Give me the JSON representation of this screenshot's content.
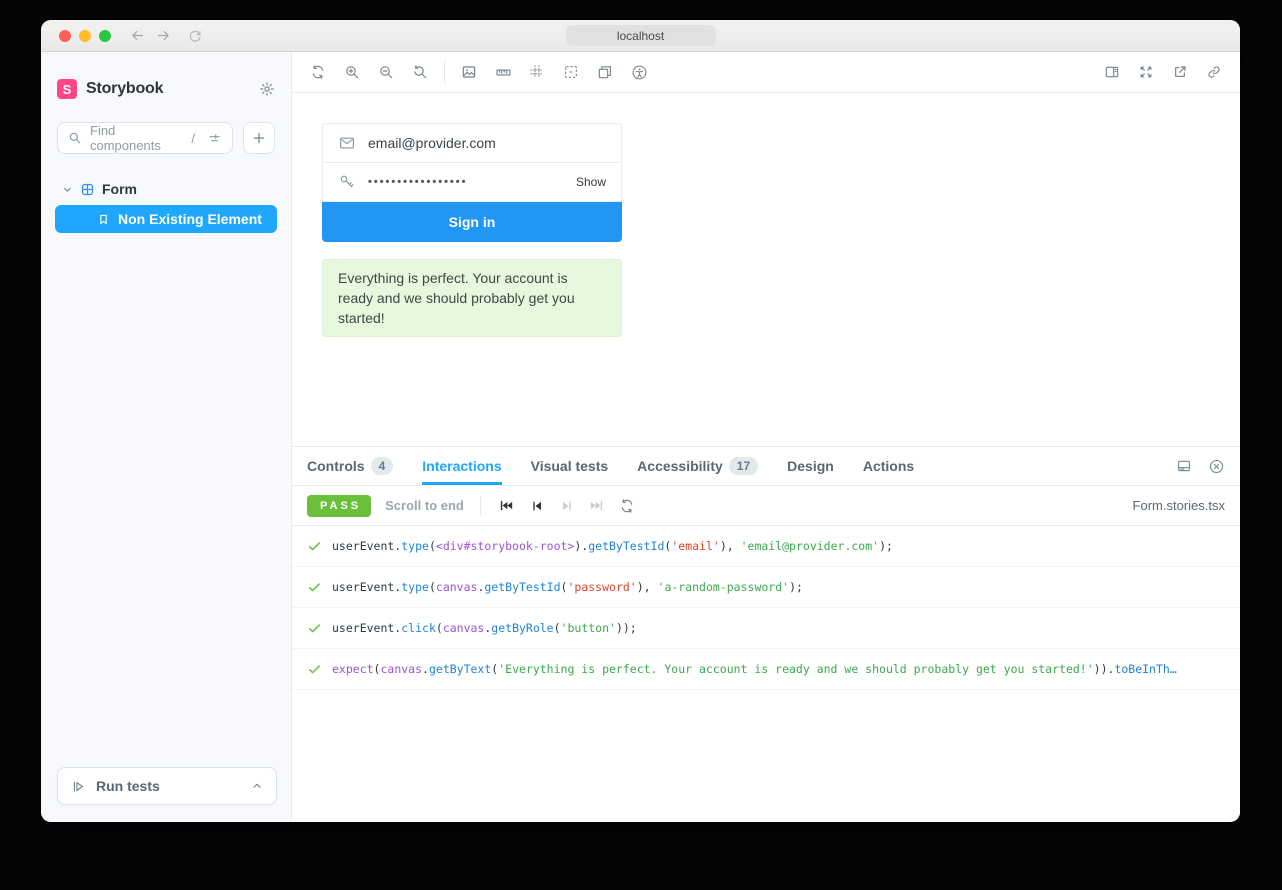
{
  "browser": {
    "url": "localhost",
    "traffic_lights": {
      "close": "#FF5F57",
      "minimize": "#FEBC2E",
      "zoom": "#28C840"
    },
    "nav_icons": [
      "back-arrow-icon",
      "forward-arrow-icon",
      "reload-icon"
    ]
  },
  "sidebar": {
    "brand": {
      "logo_letter": "S",
      "name": "Storybook",
      "logo_color": "#FF4785"
    },
    "search": {
      "placeholder": "Find components",
      "shortcut": "/",
      "icons": [
        "search-icon",
        "filter-icon",
        "plus-icon"
      ]
    },
    "tree": {
      "group": {
        "label": "Form",
        "icons": [
          "chevron-down-icon",
          "component-icon"
        ]
      },
      "selected_story": {
        "label": "Non Existing Element",
        "icon": "bookmark-icon",
        "bg": "#1EA7FD"
      }
    },
    "run_tests": {
      "label": "Run tests",
      "icons": [
        "play-tests-icon",
        "chevron-up-icon"
      ]
    }
  },
  "canvas_toolbar": {
    "left_icons": [
      "remount-icon",
      "zoom-in-icon",
      "zoom-out-icon",
      "zoom-reset-icon",
      "background-icon",
      "measure-icon",
      "grid-icon",
      "outline-icon",
      "viewport-icon",
      "accessibility-icon"
    ],
    "right_icons": [
      "panel-position-icon",
      "fullscreen-icon",
      "open-external-icon",
      "link-icon"
    ]
  },
  "story": {
    "email_value": "email@provider.com",
    "password_mask": "•••••••••••••••••",
    "show_label": "Show",
    "sign_in_label": "Sign in",
    "sign_in_color": "#2196F3",
    "success_message": "Everything is perfect. Your account is ready and we should probably get you started!",
    "success_bg": "#E6F9DF"
  },
  "panel": {
    "tabs": [
      {
        "label": "Controls",
        "badge": "4",
        "active": false
      },
      {
        "label": "Interactions",
        "badge": "",
        "active": true
      },
      {
        "label": "Visual tests",
        "badge": "",
        "active": false
      },
      {
        "label": "Accessibility",
        "badge": "17",
        "active": false
      },
      {
        "label": "Design",
        "badge": "",
        "active": false
      },
      {
        "label": "Actions",
        "badge": "",
        "active": false
      }
    ],
    "right_icons": [
      "panel-bottom-icon",
      "close-panel-icon"
    ],
    "accent": "#1EA7FD"
  },
  "interactions": {
    "status": "PASS",
    "status_color": "#6ABF3B",
    "scroll_to_end": "Scroll to end",
    "playback_icons": [
      "go-to-start-icon",
      "step-back-icon",
      "step-forward-icon",
      "go-to-end-icon",
      "rerun-icon"
    ],
    "file": "Form.stories.tsx",
    "rows": [
      [
        {
          "c": "base",
          "t": "userEvent."
        },
        {
          "c": "fn",
          "t": "type"
        },
        {
          "c": "base",
          "t": "("
        },
        {
          "c": "obj",
          "t": "<div#storybook-root>"
        },
        {
          "c": "base",
          "t": ")."
        },
        {
          "c": "fn",
          "t": "getByTestId"
        },
        {
          "c": "base",
          "t": "("
        },
        {
          "c": "strq",
          "t": "'email'"
        },
        {
          "c": "base",
          "t": "), "
        },
        {
          "c": "strg",
          "t": "'email@provider.com'"
        },
        {
          "c": "base",
          "t": ");"
        }
      ],
      [
        {
          "c": "base",
          "t": "userEvent."
        },
        {
          "c": "fn",
          "t": "type"
        },
        {
          "c": "base",
          "t": "("
        },
        {
          "c": "obj",
          "t": "canvas"
        },
        {
          "c": "base",
          "t": "."
        },
        {
          "c": "fn",
          "t": "getByTestId"
        },
        {
          "c": "base",
          "t": "("
        },
        {
          "c": "strq",
          "t": "'password'"
        },
        {
          "c": "base",
          "t": "), "
        },
        {
          "c": "strg",
          "t": "'a-random-password'"
        },
        {
          "c": "base",
          "t": ");"
        }
      ],
      [
        {
          "c": "base",
          "t": "userEvent."
        },
        {
          "c": "fn",
          "t": "click"
        },
        {
          "c": "base",
          "t": "("
        },
        {
          "c": "obj",
          "t": "canvas"
        },
        {
          "c": "base",
          "t": "."
        },
        {
          "c": "fn",
          "t": "getByRole"
        },
        {
          "c": "base",
          "t": "("
        },
        {
          "c": "strg",
          "t": "'button'"
        },
        {
          "c": "base",
          "t": "));"
        }
      ],
      [
        {
          "c": "obj",
          "t": "expect"
        },
        {
          "c": "base",
          "t": "("
        },
        {
          "c": "obj",
          "t": "canvas"
        },
        {
          "c": "base",
          "t": "."
        },
        {
          "c": "fn",
          "t": "getByText"
        },
        {
          "c": "base",
          "t": "("
        },
        {
          "c": "strg",
          "t": "'Everything is perfect. Your account is ready and we should probably get you started!'"
        },
        {
          "c": "base",
          "t": "))."
        },
        {
          "c": "fn",
          "t": "toBeInTh…"
        }
      ]
    ]
  }
}
